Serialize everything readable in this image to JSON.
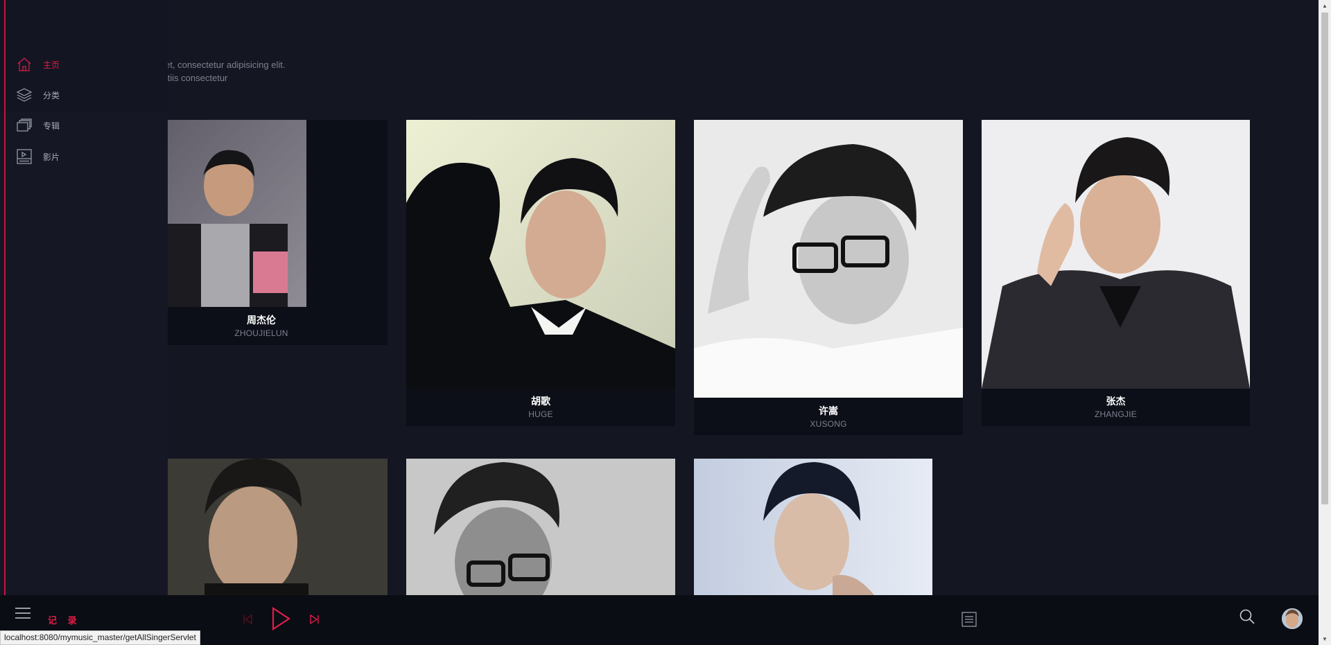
{
  "intro": {
    "line1": "n dolor sit amet, consectetur adipisicing elit.",
    "line2": "que aut blanditiis consectetur"
  },
  "sidebar": {
    "items": [
      {
        "label": "主页",
        "icon": "home-icon",
        "active": true
      },
      {
        "label": "分类",
        "icon": "layers-icon",
        "active": false
      },
      {
        "label": "专辑",
        "icon": "album-icon",
        "active": false
      },
      {
        "label": "影片",
        "icon": "video-icon",
        "active": false
      }
    ]
  },
  "singers": [
    {
      "name": "周杰伦",
      "pinyin": "ZHOUJIELUN"
    },
    {
      "name": "胡歌",
      "pinyin": "HUGE"
    },
    {
      "name": "许嵩",
      "pinyin": "XUSONG"
    },
    {
      "name": "张杰",
      "pinyin": "ZHANGJIE"
    },
    {
      "name": "",
      "pinyin": ""
    },
    {
      "name": "",
      "pinyin": ""
    },
    {
      "name": "",
      "pinyin": ""
    }
  ],
  "player": {
    "record_label": "记 录",
    "icons": [
      "menu-icon",
      "previous-icon",
      "play-icon",
      "next-icon",
      "playlist-icon",
      "search-icon",
      "avatar"
    ]
  },
  "status_bar": {
    "url": "localhost:8080/mymusic_master/getAllSingerServlet"
  },
  "colors": {
    "accent": "#e01d49",
    "background": "#141722",
    "sidebar": "#151824",
    "card": "#0d0f18"
  }
}
